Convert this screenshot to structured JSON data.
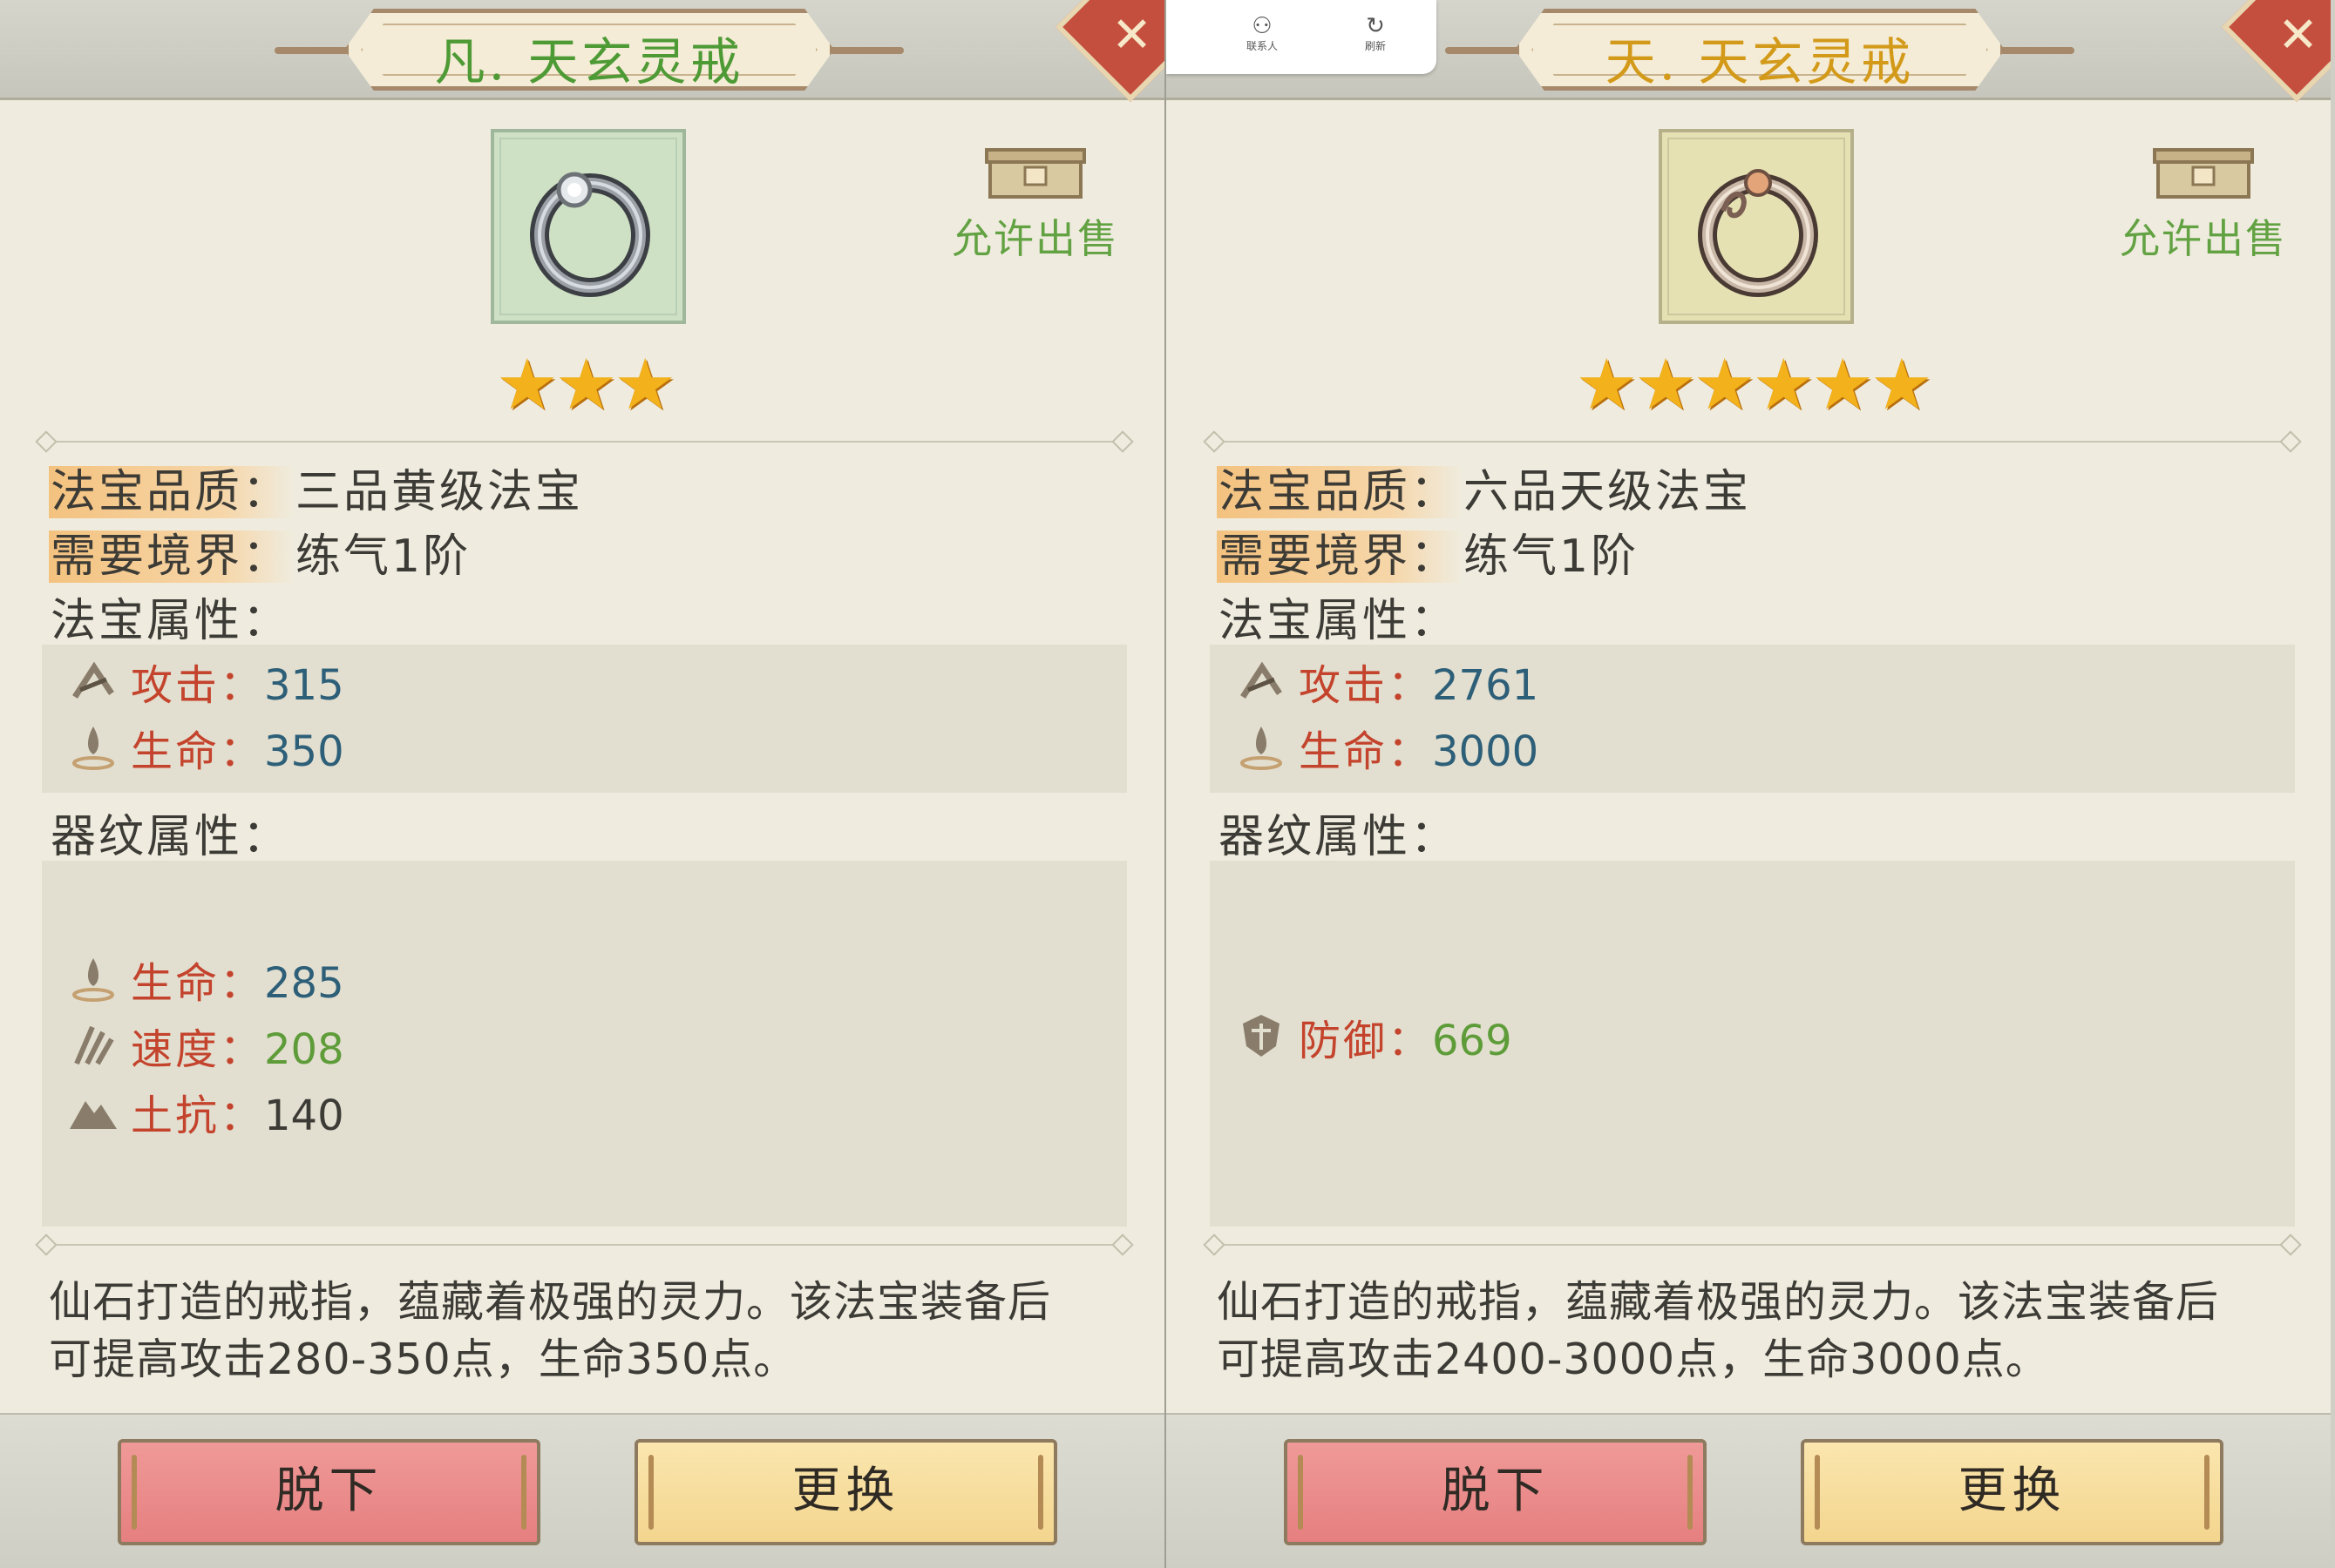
{
  "colors": {
    "title_left": "#4e9a35",
    "title_right": "#d39a1a",
    "frame_left_bg": "#cfe1c4",
    "frame_right_bg": "#e6e1b3",
    "star": "#f3b21b",
    "stat_name": "#c4432c",
    "stat_value_blue": "#2e5f78",
    "stat_value_green": "#5e9c39",
    "sale_green": "#63a243"
  },
  "overlay_toolbar": {
    "contacts_label": "联系人",
    "refresh_label": "刷新"
  },
  "panels": [
    {
      "title": "凡. 天玄灵戒",
      "sale_label": "允许出售",
      "stars": 3,
      "quality_key": "法宝品质：",
      "quality_value": "三品黄级法宝",
      "realm_key": "需要境界：",
      "realm_value": "练气1阶",
      "attr_heading": "法宝属性：",
      "attrs": [
        {
          "icon": "attack-icon",
          "name": "攻击：",
          "value": "315"
        },
        {
          "icon": "life-icon",
          "name": "生命：",
          "value": "350"
        }
      ],
      "pattern_heading": "器纹属性：",
      "patterns": [
        {
          "icon": "life-icon",
          "name": "生命：",
          "value": "285",
          "tone": "blue"
        },
        {
          "icon": "speed-icon",
          "name": "速度：",
          "value": "208",
          "tone": "green"
        },
        {
          "icon": "earth-resist-icon",
          "name": "土抗：",
          "value": "140",
          "tone": "dark"
        }
      ],
      "desc_line1": "仙石打造的戒指，蕴藏着极强的灵力。该法宝装备后",
      "desc_line2": "可提高攻击280-350点，生命350点。",
      "btn_remove": "脱下",
      "btn_replace": "更换"
    },
    {
      "title": "天. 天玄灵戒",
      "sale_label": "允许出售",
      "stars": 6,
      "quality_key": "法宝品质：",
      "quality_value": "六品天级法宝",
      "realm_key": "需要境界：",
      "realm_value": "练气1阶",
      "attr_heading": "法宝属性：",
      "attrs": [
        {
          "icon": "attack-icon",
          "name": "攻击：",
          "value": "2761"
        },
        {
          "icon": "life-icon",
          "name": "生命：",
          "value": "3000"
        }
      ],
      "pattern_heading": "器纹属性：",
      "patterns": [
        {
          "icon": "defense-icon",
          "name": "防御：",
          "value": "669",
          "tone": "green"
        }
      ],
      "desc_line1": "仙石打造的戒指，蕴藏着极强的灵力。该法宝装备后",
      "desc_line2": "可提高攻击2400-3000点，生命3000点。",
      "btn_remove": "脱下",
      "btn_replace": "更换"
    }
  ]
}
